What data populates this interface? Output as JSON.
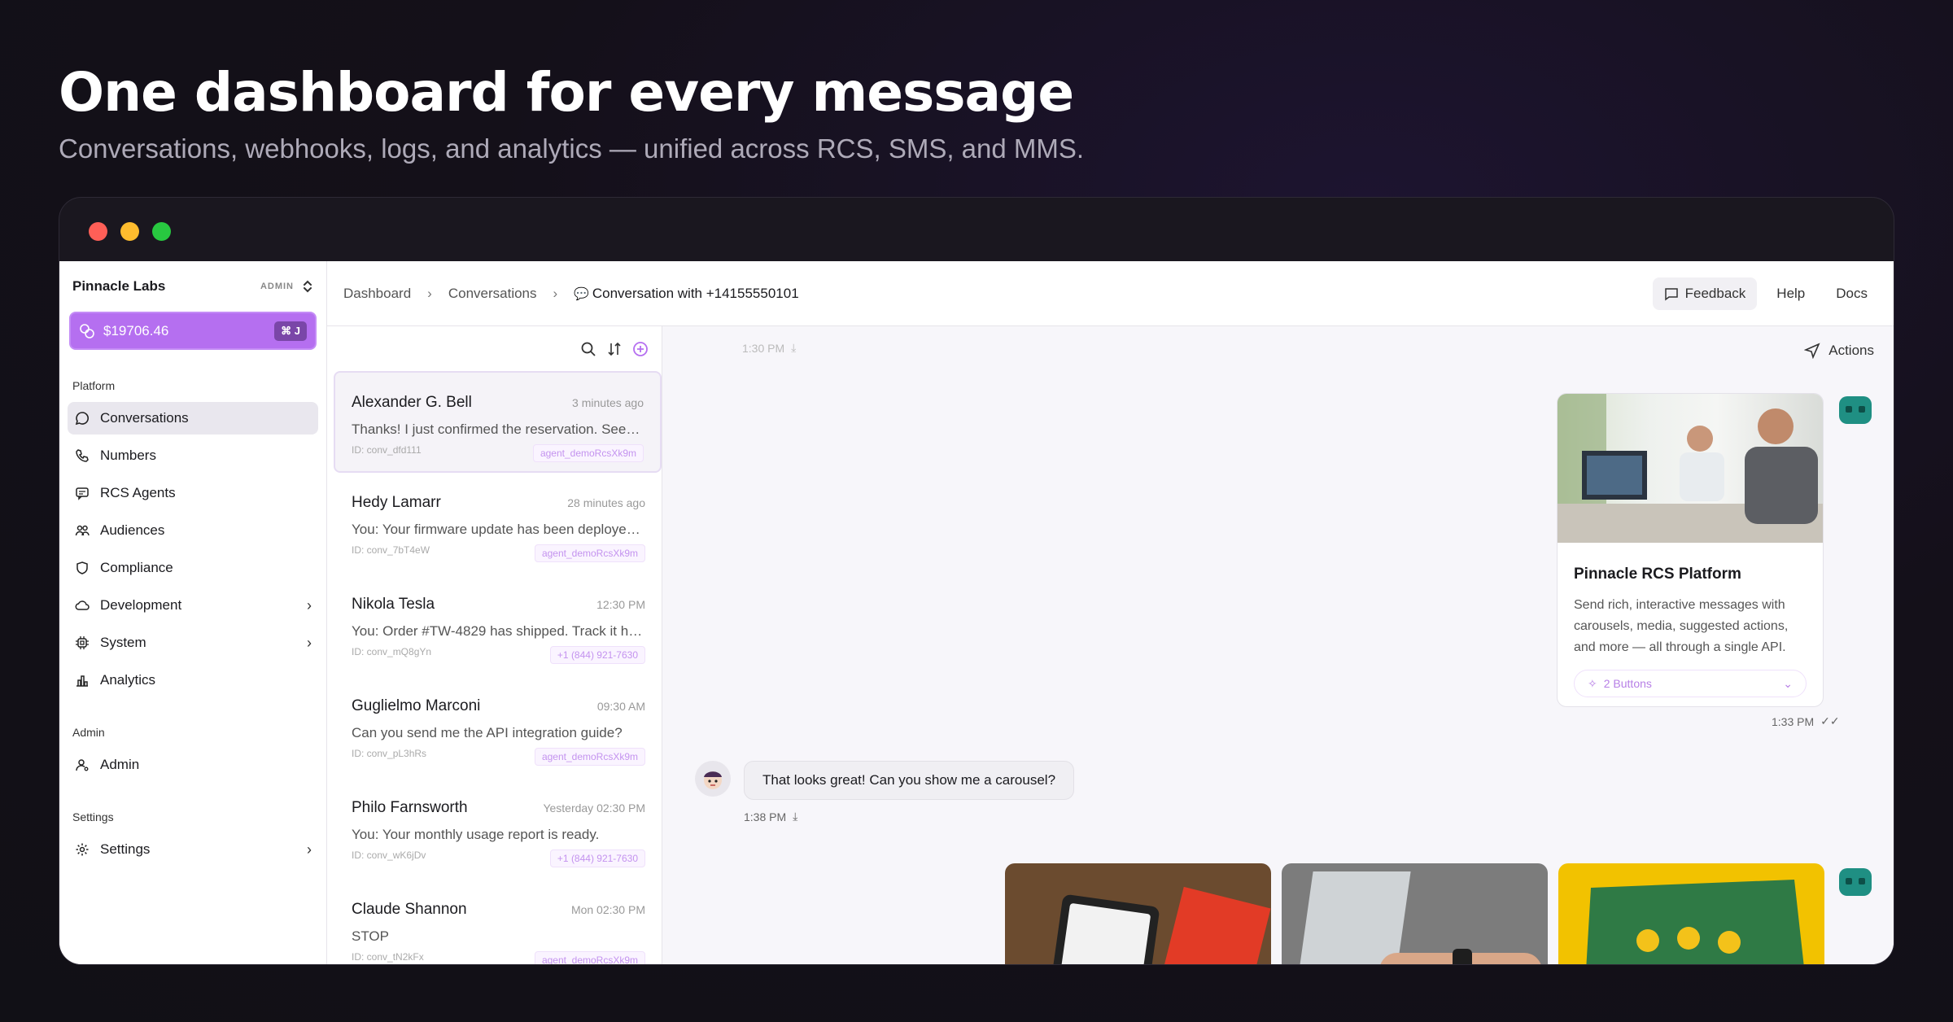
{
  "hero": {
    "title": "One dashboard for every message",
    "subtitle": "Conversations, webhooks, logs, and analytics — unified across RCS, SMS, and MMS."
  },
  "window": {
    "dots": [
      "#ff5f57",
      "#febc2e",
      "#28c840"
    ]
  },
  "sidebar": {
    "org_name": "Pinnacle Labs",
    "org_role": "ADMIN",
    "credit": "$19706.46",
    "credit_shortcut": "⌘ J",
    "sections": [
      {
        "label": "Platform"
      },
      {
        "label": "Admin"
      },
      {
        "label": "Settings"
      }
    ],
    "items": [
      {
        "label": "Conversations",
        "icon": "chat-bubble-icon",
        "active": true
      },
      {
        "label": "Numbers",
        "icon": "phone-icon"
      },
      {
        "label": "RCS Agents",
        "icon": "message-square-icon"
      },
      {
        "label": "Audiences",
        "icon": "users-icon"
      },
      {
        "label": "Compliance",
        "icon": "shield-icon"
      },
      {
        "label": "Development",
        "icon": "cloud-icon"
      },
      {
        "label": "System",
        "icon": "cpu-icon"
      },
      {
        "label": "Analytics",
        "icon": "bar-chart-icon"
      },
      {
        "label": "Admin",
        "icon": "user-icon"
      },
      {
        "label": "Settings",
        "icon": "gear-icon"
      }
    ]
  },
  "topbar": {
    "breadcrumb": [
      "Dashboard",
      "Conversations",
      "Conversation with +14155550101"
    ],
    "feedback": "Feedback",
    "help": "Help",
    "docs": "Docs"
  },
  "conversations": [
    {
      "name": "Alexander G. Bell",
      "time": "3 minutes ago",
      "message": "Thanks! I just confirmed the reservation. See…",
      "id": "ID: conv_dfd111",
      "tag": "agent_demoRcsXk9m"
    },
    {
      "name": "Hedy Lamarr",
      "time": "28 minutes ago",
      "message": "You: Your firmware update has been deployed…",
      "id": "ID: conv_7bT4eW",
      "tag": "agent_demoRcsXk9m"
    },
    {
      "name": "Nikola Tesla",
      "time": "12:30 PM",
      "message": "You: Order #TW-4829 has shipped. Track it her…",
      "id": "ID: conv_mQ8gYn",
      "tag": "+1 (844) 921-7630"
    },
    {
      "name": "Guglielmo Marconi",
      "time": "09:30 AM",
      "message": "Can you send me the API integration guide?",
      "id": "ID: conv_pL3hRs",
      "tag": "agent_demoRcsXk9m"
    },
    {
      "name": "Philo Farnsworth",
      "time": "Yesterday 02:30 PM",
      "message": "You: Your monthly usage report is ready.",
      "id": "ID: conv_wK6jDv",
      "tag": "+1 (844) 921-7630"
    },
    {
      "name": "Claude Shannon",
      "time": "Mon 02:30 PM",
      "message": "STOP",
      "id": "ID: conv_tN2kFx",
      "tag": "agent_demoRcsXk9m"
    }
  ],
  "chat": {
    "actions": "Actions",
    "ts_top": "1:30 PM",
    "card": {
      "title": "Pinnacle RCS Platform",
      "body": "Send rich, interactive messages with carousels, media, suggested actions, and more — all through a single API.",
      "buttons": "2 Buttons",
      "time": "1:33 PM"
    },
    "user_message": "That looks great! Can you show me a carousel?",
    "user_time": "1:38 PM"
  }
}
